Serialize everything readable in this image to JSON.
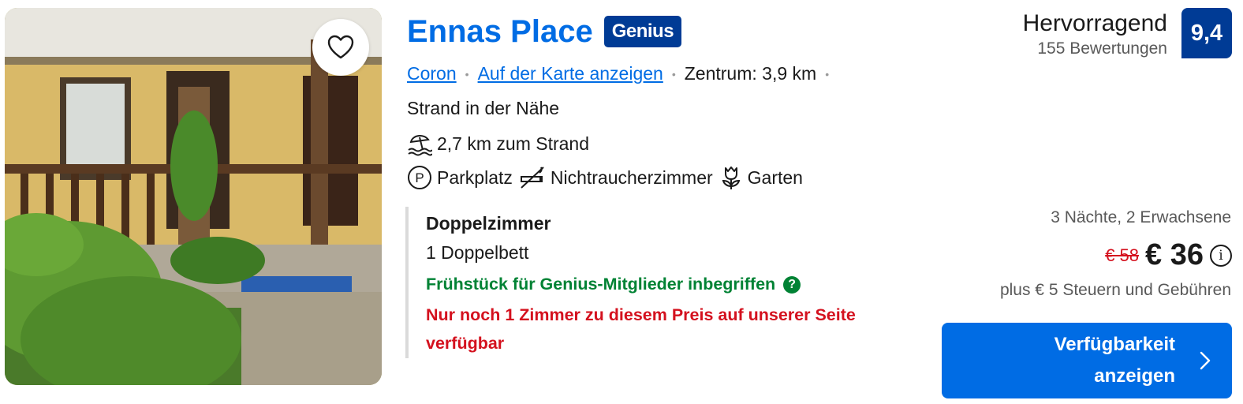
{
  "hotel": {
    "name": "Ennas Place",
    "badge": "Genius",
    "location_link": "Coron",
    "map_link": "Auf der Karte anzeigen",
    "distance": "Zentrum: 3,9 km",
    "subtitle": "Strand in der Nähe",
    "beach": "2,7 km zum Strand",
    "facilities": [
      "Parkplatz",
      "Nichtraucherzimmer",
      "Garten"
    ]
  },
  "rating": {
    "word": "Hervorragend",
    "reviews": "155 Bewertungen",
    "score": "9,4"
  },
  "room": {
    "type": "Doppelzimmer",
    "bed": "1 Doppelbett",
    "breakfast": "Frühstück für Genius-Mitglieder inbegriffen",
    "scarcity": "Nur noch 1 Zimmer zu diesem Preis auf unserer Seite verfügbar"
  },
  "price": {
    "stay": "3 Nächte, 2 Erwachsene",
    "old": "€ 58",
    "new": "€ 36",
    "taxes": "plus € 5 Steuern und Gebühren"
  },
  "cta": {
    "label": "Verfügbarkeit anzeigen"
  },
  "icons": {
    "favorite": "heart-icon",
    "beach": "beach-umbrella-icon",
    "parking": "parking-icon",
    "nonsmoking": "no-smoking-icon",
    "garden": "flower-icon",
    "help": "question-icon",
    "info": "info-icon",
    "arrow": "chevron-right-icon"
  },
  "colors": {
    "link": "#006ce4",
    "badge": "#003b95",
    "green": "#008234",
    "red": "#d4111e"
  }
}
